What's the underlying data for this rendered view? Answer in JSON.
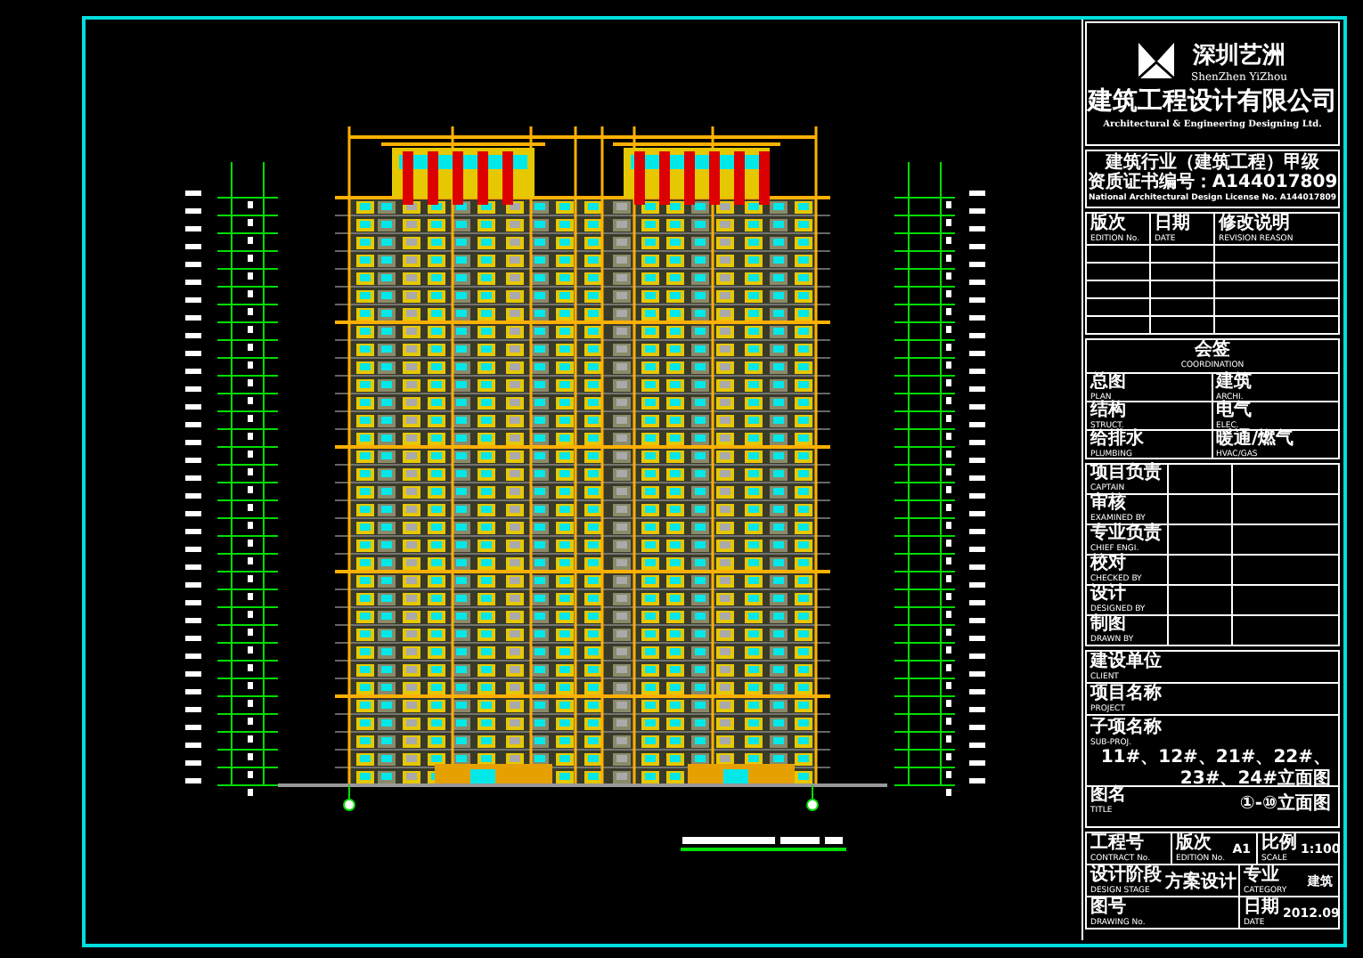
{
  "company": {
    "name_cn": "深圳艺洲",
    "name_pinyin": "ShenZhen YiZhou",
    "full_cn": "建筑工程设计有限公司",
    "full_en": "Architectural & Engineering Designing Ltd."
  },
  "qualification": [
    "建筑行业（建筑工程）甲级",
    "资质证书编号：A144017809",
    "National Architectural Design License No. A144017809"
  ],
  "revision_columns": [
    {
      "cn": "版次",
      "en": "EDITION No."
    },
    {
      "cn": "日期",
      "en": "DATE"
    },
    {
      "cn": "修改说明",
      "en": "REVISION REASON"
    }
  ],
  "coordination": {
    "cn": "会签",
    "en": "COORDINATION"
  },
  "coordination_items": [
    {
      "cn": "总图",
      "en": "PLAN"
    },
    {
      "cn": "建筑",
      "en": "ARCHI."
    },
    {
      "cn": "结构",
      "en": "STRUCT."
    },
    {
      "cn": "电气",
      "en": "ELEC."
    },
    {
      "cn": "给排水",
      "en": "PLUMBING"
    },
    {
      "cn": "暖通/燃气",
      "en": "HVAC/GAS"
    }
  ],
  "staff": [
    {
      "cn": "项目负责",
      "en": "CAPTAIN"
    },
    {
      "cn": "审核",
      "en": "EXAMINED BY"
    },
    {
      "cn": "专业负责",
      "en": "CHIEF ENGI."
    },
    {
      "cn": "校对",
      "en": "CHECKED BY"
    },
    {
      "cn": "设计",
      "en": "DESIGNED BY"
    },
    {
      "cn": "制图",
      "en": "DRAWN BY"
    }
  ],
  "project_info": [
    {
      "cn": "建设单位",
      "en": "CLIENT"
    },
    {
      "cn": "项目名称",
      "en": "PROJECT"
    },
    {
      "cn": "子项名称",
      "en": "SUB-PROJ.",
      "value": "11#、12#、21#、22#、23#、24#立面图"
    },
    {
      "cn": "图名",
      "en": "TITLE",
      "value": "①-⑩立面图"
    }
  ],
  "footer": [
    [
      {
        "cn": "工程号",
        "en": "CONTRACT No."
      },
      {
        "cn": "版次",
        "en": "EDITION No.",
        "value": "A1"
      },
      {
        "cn": "比例",
        "en": "SCALE",
        "value": "1:100"
      }
    ],
    [
      {
        "cn": "设计阶段",
        "en": "DESIGN STAGE",
        "value": "方案设计"
      },
      {
        "cn": "专业",
        "en": "CATEGORY",
        "value": "建筑"
      }
    ],
    [
      {
        "cn": "图号",
        "en": "DRAWING No."
      },
      {
        "cn": "日期",
        "en": "DATE",
        "value": "2012.09"
      }
    ]
  ]
}
